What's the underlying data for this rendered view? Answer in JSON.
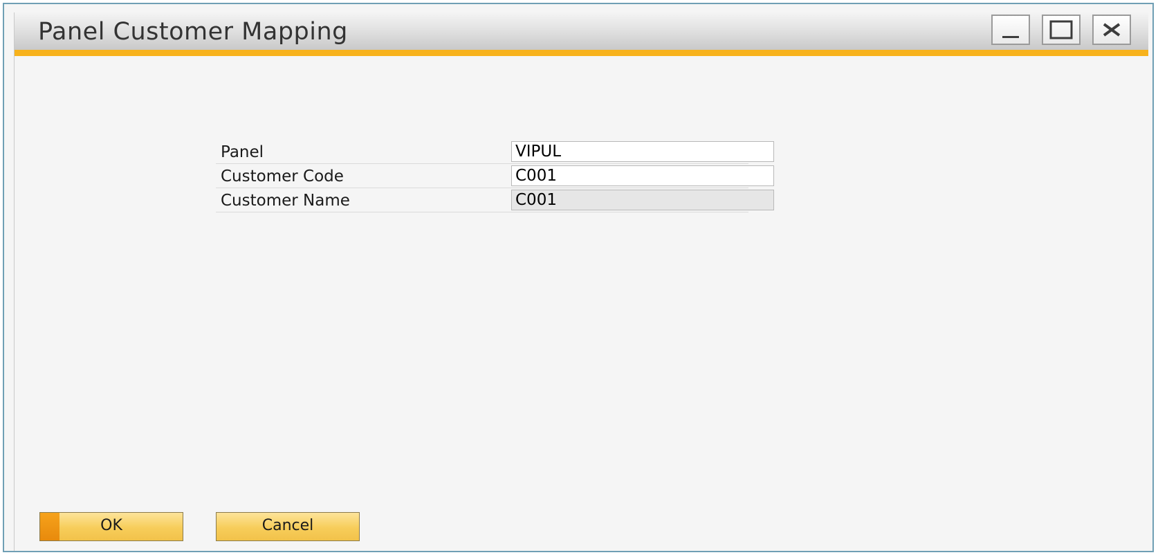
{
  "window": {
    "title": "Panel Customer Mapping"
  },
  "title_buttons": {
    "minimize_icon": "minimize-icon",
    "maximize_icon": "maximize-icon",
    "close_icon": "close-icon"
  },
  "form": {
    "fields": [
      {
        "label": "Panel",
        "value": "VIPUL",
        "editable": true
      },
      {
        "label": "Customer Code",
        "value": "C001",
        "editable": true
      },
      {
        "label": "Customer Name",
        "value": "C001",
        "editable": false
      }
    ]
  },
  "buttons": {
    "ok_label": "OK",
    "cancel_label": "Cancel"
  },
  "colors": {
    "accent": "#f7b21c",
    "button": "#f7cd5a",
    "window_border": "#6f9fb4",
    "readonly_field": "#e6e6e6"
  }
}
